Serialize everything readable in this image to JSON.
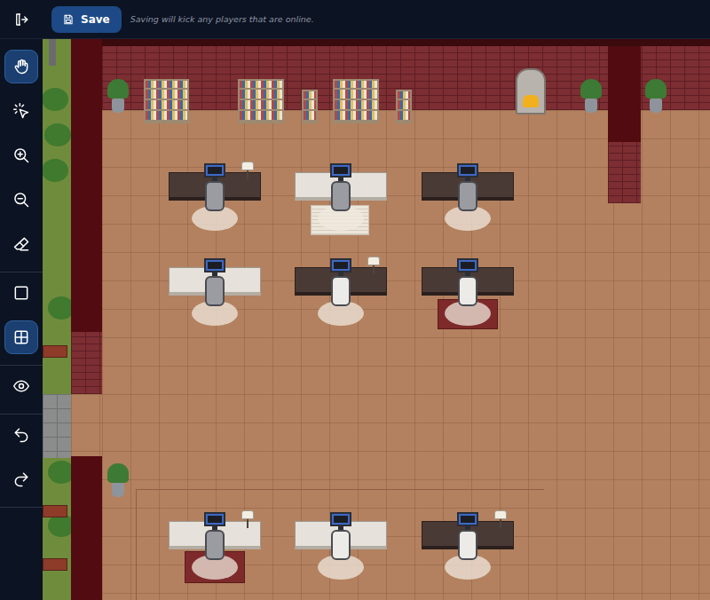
{
  "topbar": {
    "save": {
      "label": "Save"
    },
    "hint": "Saving will kick any players that are online."
  },
  "tools": [
    {
      "selected": true
    },
    {
      "selected": false
    },
    {
      "selected": false
    },
    {
      "selected": false
    },
    {
      "selected": false
    },
    {
      "selected": false
    },
    {
      "selected": true
    },
    {
      "selected": false
    },
    {
      "selected": false
    },
    {
      "selected": false
    }
  ],
  "desks": [
    {
      "kind": "dark"
    },
    {
      "kind": "light"
    },
    {
      "kind": "dark"
    },
    {
      "kind": "light"
    },
    {
      "kind": "dark"
    },
    {
      "kind": "dark"
    },
    {
      "kind": "light"
    },
    {
      "kind": "light"
    },
    {
      "kind": "dark"
    }
  ]
}
